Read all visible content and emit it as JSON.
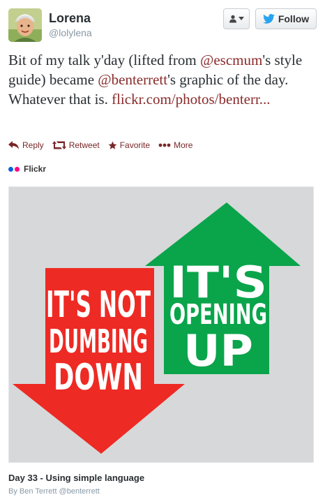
{
  "profile": {
    "name": "Lorena",
    "handle": "@lolylena"
  },
  "buttons": {
    "follow_label": "Follow"
  },
  "tweet": {
    "text_1": "Bit of my talk y'day (lifted from ",
    "mention_1": "@escmum",
    "text_2": "'s style guide) became ",
    "mention_2": "@benterrett",
    "text_3": "'s graphic of the day. Whatever that is. ",
    "link": "flickr.com/photos/benterr..."
  },
  "actions": [
    {
      "label": "Reply",
      "icon": "reply-icon"
    },
    {
      "label": "Retweet",
      "icon": "retweet-icon"
    },
    {
      "label": "Favorite",
      "icon": "star-icon"
    },
    {
      "label": "More",
      "icon": "more-icon"
    }
  ],
  "media": {
    "source": "Flickr",
    "down_arrow_lines": [
      "IT'S NOT",
      "DUMBING",
      "DOWN"
    ],
    "up_arrow_lines": [
      "IT'S",
      "OPENING",
      "UP"
    ],
    "caption": "Day 33 - Using simple language",
    "credit_by": "By Ben Terrett @benterrett"
  },
  "colors": {
    "link": "#8a2b2b",
    "red_arrow": "#ee2a24",
    "green_arrow": "#0aa44b",
    "flickr_blue": "#0063dc",
    "flickr_pink": "#ff0084"
  }
}
